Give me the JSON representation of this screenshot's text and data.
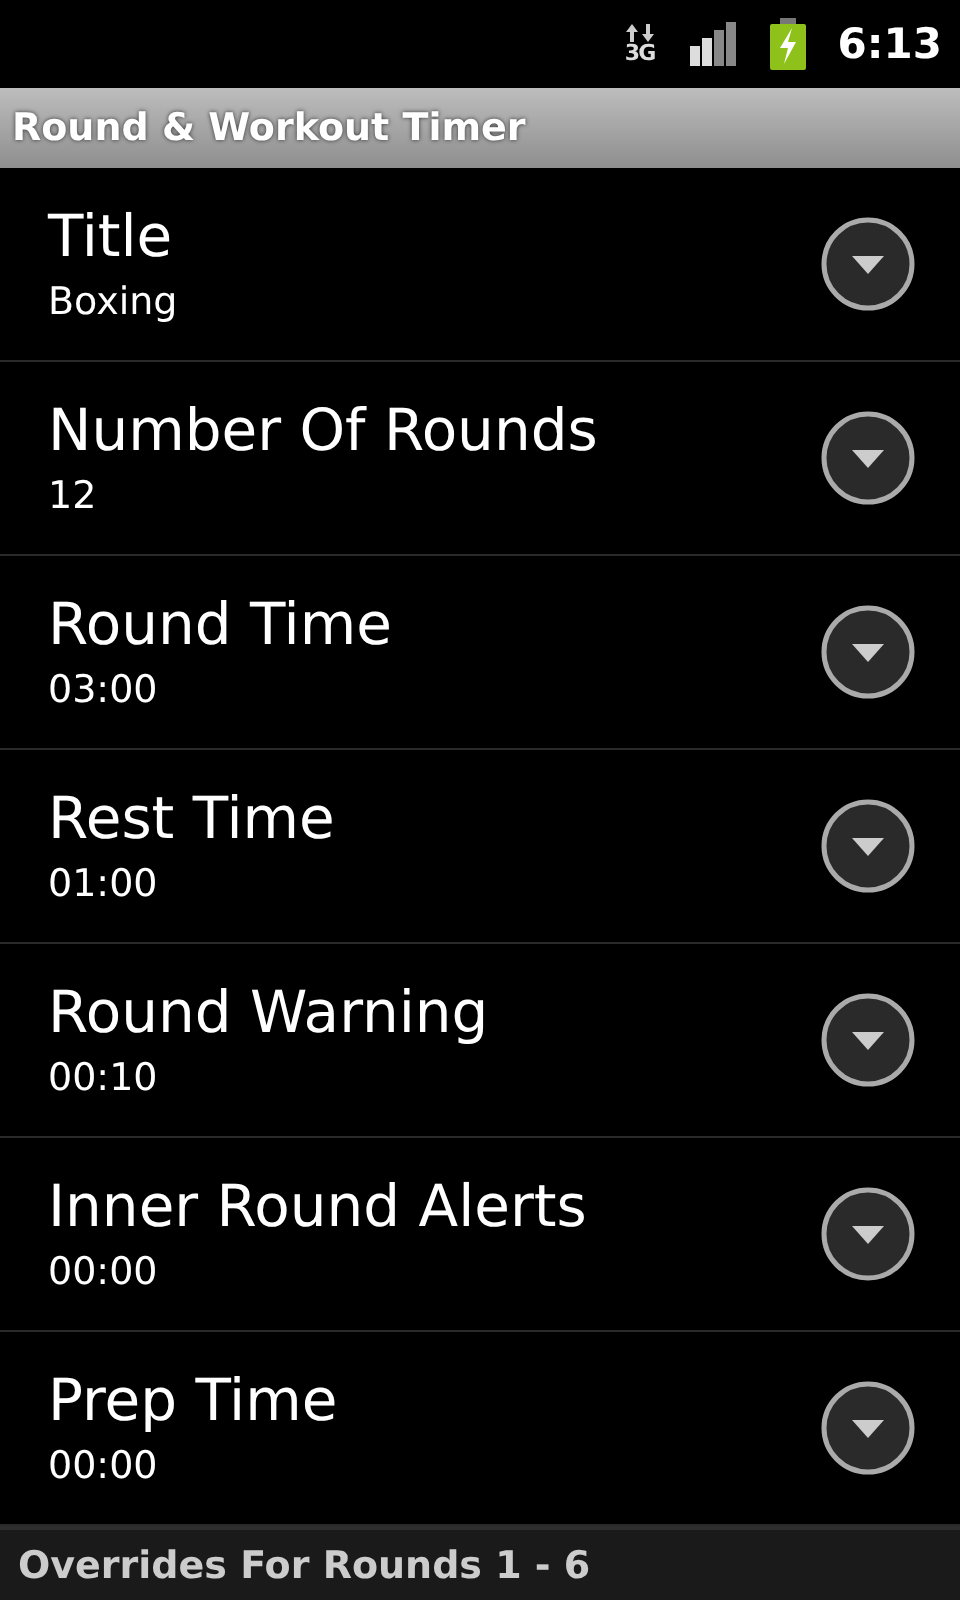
{
  "status_bar": {
    "network": "3G",
    "time": "6:13"
  },
  "window": {
    "title": "Round & Workout Timer"
  },
  "settings": [
    {
      "label": "Title",
      "value": "Boxing"
    },
    {
      "label": "Number Of Rounds",
      "value": "12"
    },
    {
      "label": "Round Time",
      "value": "03:00"
    },
    {
      "label": "Rest Time",
      "value": "01:00"
    },
    {
      "label": "Round Warning",
      "value": "00:10"
    },
    {
      "label": "Inner Round Alerts",
      "value": "00:00"
    },
    {
      "label": "Prep Time",
      "value": "00:00"
    }
  ],
  "section_header": "Overrides For Rounds 1 - 6"
}
